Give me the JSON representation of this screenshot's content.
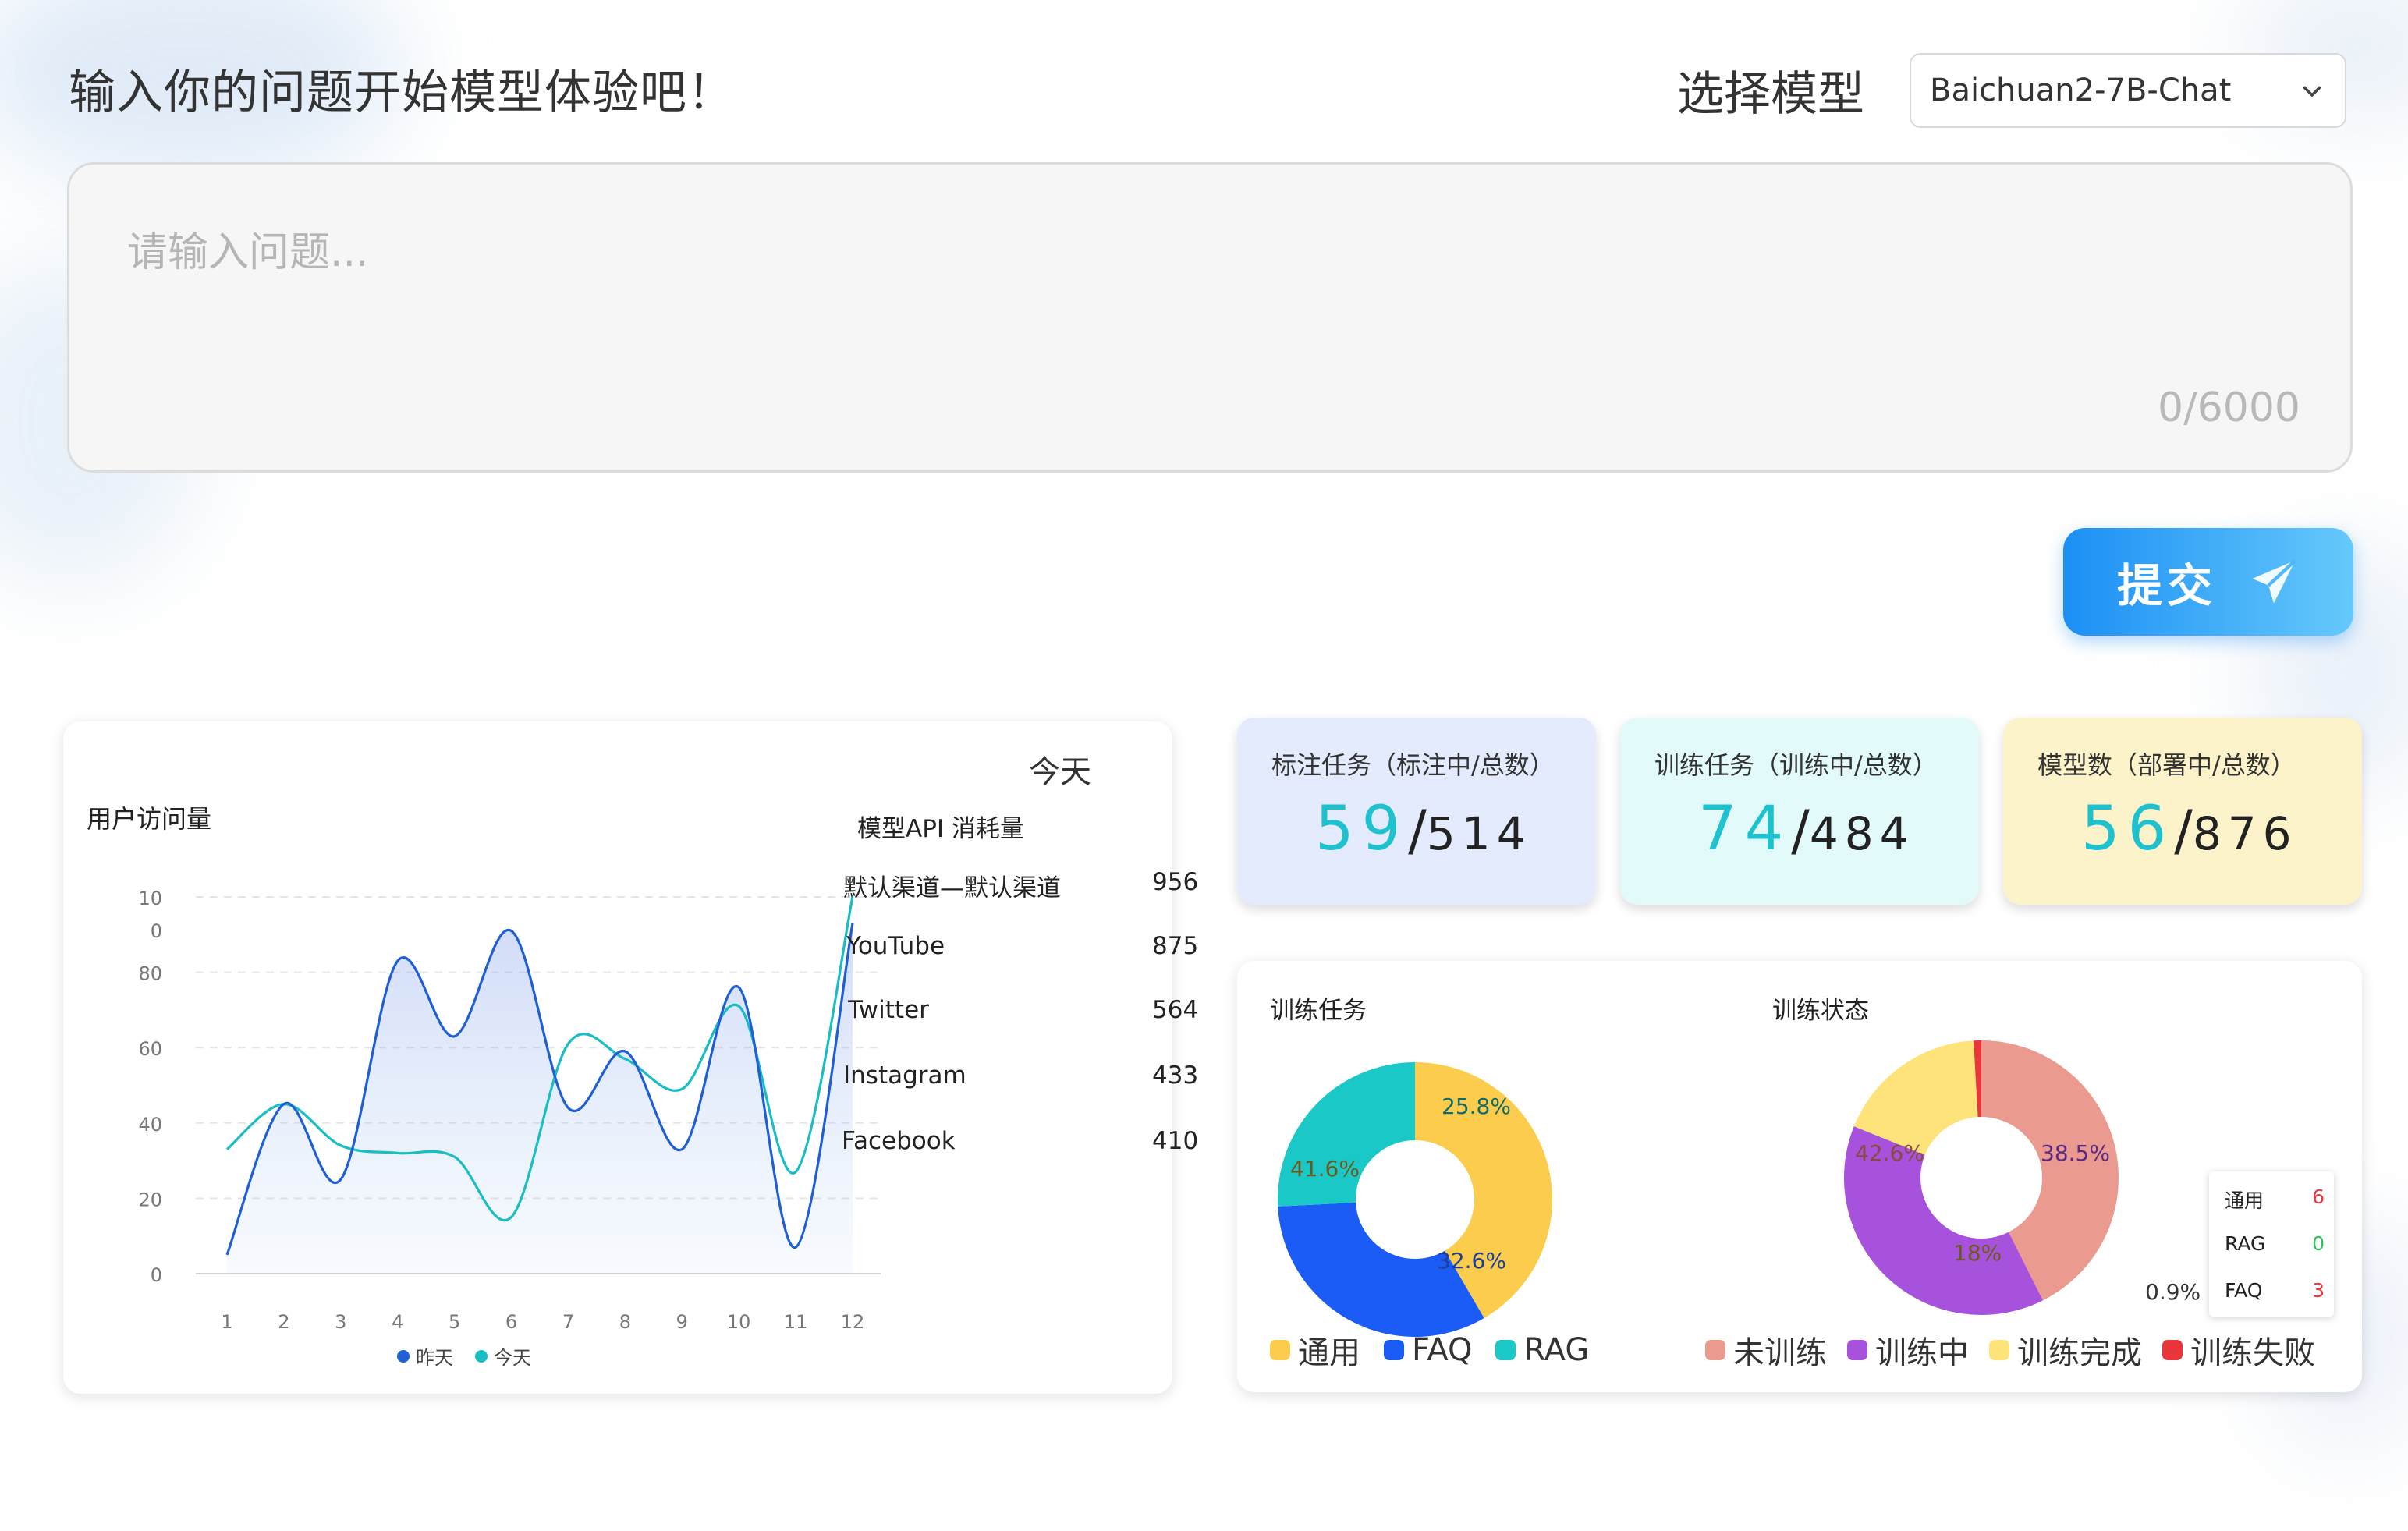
{
  "header": {
    "title": "输入你的问题开始模型体验吧！",
    "model_label": "选择模型",
    "selected_model": "Baichuan2-7B-Chat"
  },
  "question": {
    "placeholder": "请输入问题...",
    "counter": "0/6000"
  },
  "submit": {
    "label": "提交"
  },
  "left_panel": {
    "date_label": "今天",
    "visits": {
      "title": "用户访问量",
      "legend": [
        "昨天",
        "今天"
      ],
      "colors": [
        "#1f5fd6",
        "#19bdc4"
      ]
    },
    "api": {
      "title": "模型API 消耗量",
      "rows": [
        {
          "name": "默认渠道—默认渠道",
          "value": "956"
        },
        {
          "name": "YouTube",
          "value": "875"
        },
        {
          "name": "Twitter",
          "value": "564"
        },
        {
          "name": "Instagram",
          "value": "433"
        },
        {
          "name": "Facebook",
          "value": "410"
        }
      ]
    }
  },
  "stats": [
    {
      "label": "标注任务（标注中/总数）",
      "current": "59",
      "total": "514",
      "bg": "#e4ebfd"
    },
    {
      "label": "训练任务（训练中/总数）",
      "current": "74",
      "total": "484",
      "bg": "#e2fbfa"
    },
    {
      "label": "模型数（部署中/总数）",
      "current": "56",
      "total": "876",
      "bg": "#fdf3ca"
    }
  ],
  "donut_task": {
    "title": "训练任务",
    "slices": [
      {
        "name": "通用",
        "label": "41.6%",
        "value": 41.6,
        "color": "#fccd4c"
      },
      {
        "name": "FAQ",
        "label": "32.6%",
        "value": 32.6,
        "color": "#1a5cf5"
      },
      {
        "name": "RAG",
        "label": "25.8%",
        "value": 25.8,
        "color": "#1bc8c8"
      }
    ]
  },
  "donut_status": {
    "title": "训练状态",
    "slices": [
      {
        "name": "未训练",
        "label": "42.6%",
        "value": 42.6,
        "color": "#eb9a90"
      },
      {
        "name": "训练中",
        "label": "38.5%",
        "value": 38.5,
        "color": "#a652dc"
      },
      {
        "name": "训练完成",
        "label": "18%",
        "value": 18,
        "color": "#fde37a"
      },
      {
        "name": "训练失败",
        "label": "0.9%",
        "value": 0.9,
        "color": "#e8363a"
      }
    ],
    "tooltip": [
      {
        "name": "通用",
        "value": "6",
        "color": "#e8363a"
      },
      {
        "name": "RAG",
        "value": "0",
        "color": "#2cc25b"
      },
      {
        "name": "FAQ",
        "value": "3",
        "color": "#e8363a"
      }
    ]
  },
  "chart_data": {
    "type": "line",
    "title": "用户访问量",
    "x": [
      1,
      2,
      3,
      4,
      5,
      6,
      7,
      8,
      9,
      10,
      11,
      12
    ],
    "ylim": [
      0,
      100
    ],
    "yticks": [
      "0",
      "20",
      "40",
      "60",
      "80",
      "10\n0"
    ],
    "series": [
      {
        "name": "昨天",
        "values": [
          5,
          45,
          25,
          83,
          63,
          91,
          44,
          59,
          33,
          76,
          7,
          93
        ]
      },
      {
        "name": "今天",
        "values": [
          33,
          45,
          34,
          32,
          31,
          15,
          61,
          57,
          49,
          71,
          27,
          100
        ]
      }
    ],
    "grid": true,
    "legend": "bottom"
  }
}
